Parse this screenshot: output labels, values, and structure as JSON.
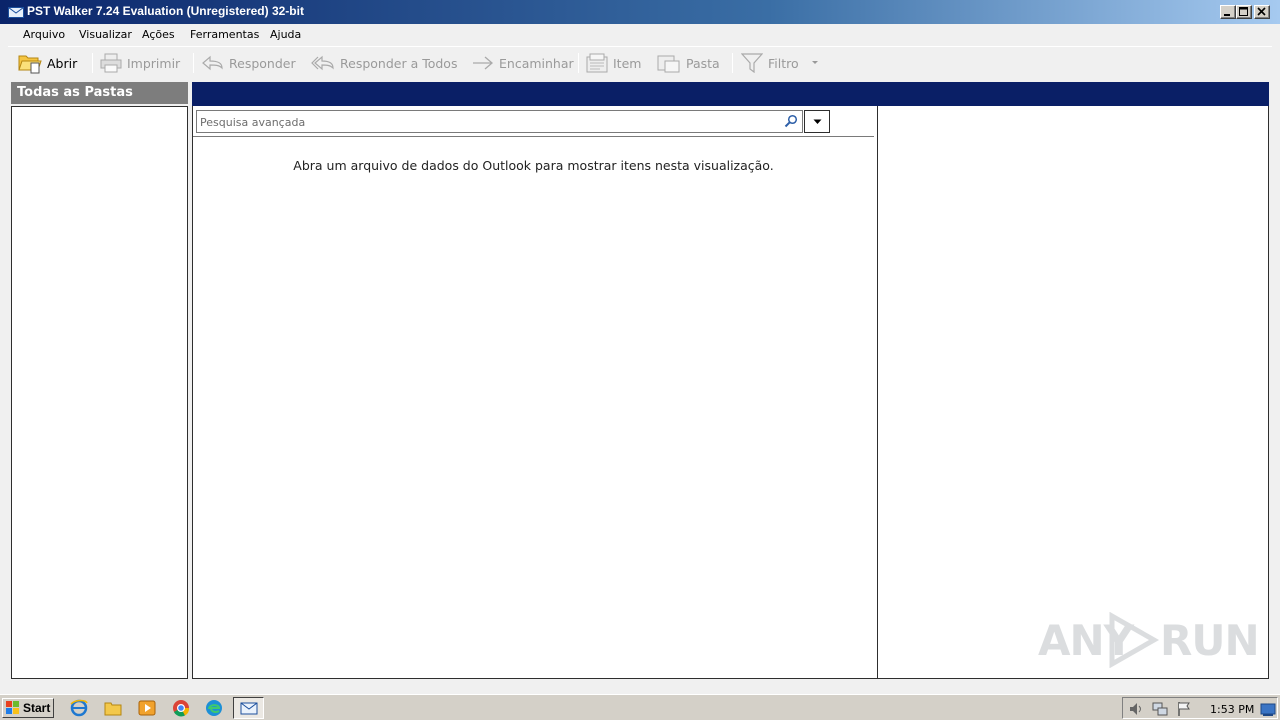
{
  "window": {
    "title": "PST Walker 7.24 Evaluation (Unregistered) 32-bit"
  },
  "menu": {
    "items": [
      "Arquivo",
      "Visualizar",
      "Ações",
      "Ferramentas",
      "Ajuda"
    ]
  },
  "toolbar": {
    "open_label": "Abrir",
    "print_label": "Imprimir",
    "reply_label": "Responder",
    "reply_all_label": "Responder a Todos",
    "forward_label": "Encaminhar",
    "item_label": "Item",
    "folder_label": "Pasta",
    "filter_label": "Filtro"
  },
  "folders": {
    "header": "Todas as Pastas"
  },
  "search": {
    "placeholder": "Pesquisa avançada",
    "value": ""
  },
  "list": {
    "empty_message": "Abra um arquivo de dados do Outlook para mostrar itens nesta visualização."
  },
  "watermark": {
    "left_text": "ANY",
    "right_text": "RUN"
  },
  "taskbar": {
    "start_label": "Start",
    "clock": "1:53 PM"
  },
  "colors": {
    "title_gradient_start": "#0a246a",
    "pane_header_dark": "#0a1f66",
    "folders_header_gray": "#7d7d7d",
    "disabled_text": "#9a9a9a"
  }
}
